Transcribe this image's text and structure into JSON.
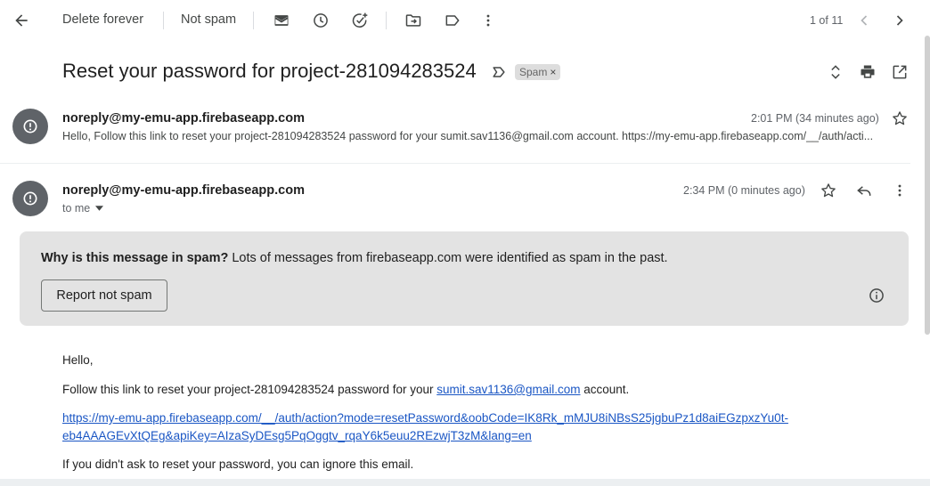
{
  "toolbar": {
    "delete_forever": "Delete forever",
    "not_spam": "Not spam",
    "pagination": "1 of 11"
  },
  "subject": "Reset your password for project-281094283524",
  "labels": {
    "spam_chip": "Spam"
  },
  "collapsed_message": {
    "sender": "noreply@my-emu-app.firebaseapp.com",
    "time": "2:01 PM (34 minutes ago)",
    "snippet": "Hello, Follow this link to reset your project-281094283524 password for your sumit.sav1136@gmail.com account. https://my-emu-app.firebaseapp.com/__/auth/acti..."
  },
  "open_message": {
    "sender": "noreply@my-emu-app.firebaseapp.com",
    "time": "2:34 PM (0 minutes ago)",
    "to": "to me"
  },
  "spam_notice": {
    "question": "Why is this message in spam?",
    "explanation": "Lots of messages from firebaseapp.com were identified as spam in the past.",
    "report_button": "Report not spam"
  },
  "body": {
    "greeting": "Hello,",
    "line1_before": "Follow this link to reset your project-281094283524 password for your ",
    "line1_email": "sumit.sav1136@gmail.com",
    "line1_after": " account.",
    "link_line1": "https://my-emu-app.firebaseapp.com/__/auth/action?mode=resetPassword&oobCode=IK8Rk_mMJU8iNBsS25jgbuPz1d8aiEGzpxzYu0t-",
    "link_line2": "eb4AAAGEvXtQEg&apiKey=AIzaSyDEsg5PqOggtv_rqaY6k5euu2REzwjT3zM&lang=en",
    "ignore": "If you didn't ask to reset your password, you can ignore this email."
  },
  "icons": {
    "back": "arrow-back-icon",
    "mail": "mark-unread-icon",
    "snooze": "clock-icon",
    "task": "add-task-icon",
    "move": "move-to-icon",
    "label": "label-icon",
    "more": "more-vert-icon",
    "prev": "chevron-left-icon",
    "next": "chevron-right-icon",
    "expand": "expand-all-icon",
    "print": "print-icon",
    "popout": "open-new-window-icon",
    "star": "star-icon",
    "reply": "reply-icon",
    "info": "info-icon",
    "important": "important-marker-icon"
  }
}
